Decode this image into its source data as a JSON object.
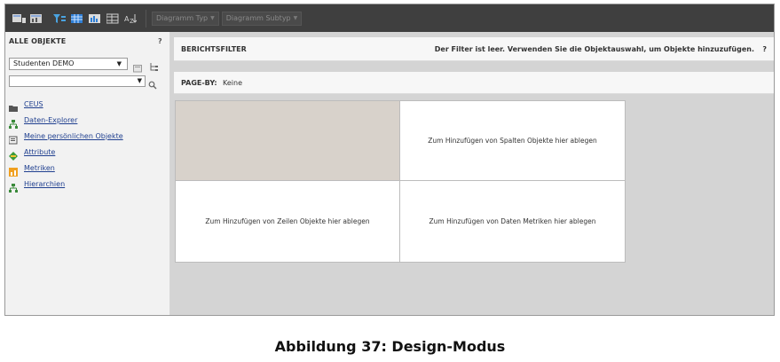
{
  "toolbar": {
    "icons": [
      "grid-view-icon",
      "grid-graph-view-icon",
      "filter-icon",
      "table-view-icon",
      "graph-view-icon",
      "layout-icon",
      "sort-icon"
    ],
    "diagramm_typ": "Diagramm Typ",
    "diagramm_subtyp": "Diagramm Subtyp"
  },
  "left_panel": {
    "title": "ALLE OBJEKTE",
    "help": "?",
    "project_select": "Studenten DEMO",
    "search_value": "",
    "tree": [
      {
        "label": "CEUS",
        "icon": "folder-icon"
      },
      {
        "label": "Daten-Explorer",
        "icon": "hierarchy-icon"
      },
      {
        "label": "Meine persönlichen Objekte",
        "icon": "personal-folder-icon"
      },
      {
        "label": "Attribute",
        "icon": "attribute-icon"
      },
      {
        "label": "Metriken",
        "icon": "metric-icon"
      },
      {
        "label": "Hierarchien",
        "icon": "hierarchy-icon"
      }
    ]
  },
  "main": {
    "filter_title": "BERICHTSFILTER",
    "filter_message": "Der Filter ist leer. Verwenden Sie die Objektauswahl, um Objekte hinzuzufügen.",
    "filter_help": "?",
    "pageby_label": "PAGE-BY:",
    "pageby_value": "Keine",
    "drop_columns": "Zum Hinzufügen von Spalten Objekte hier ablegen",
    "drop_rows": "Zum Hinzufügen von Zeilen Objekte hier ablegen",
    "drop_metrics": "Zum Hinzufügen von Daten Metriken hier ablegen"
  },
  "caption": "Abbildung 37: Design-Modus",
  "colors": {
    "toolbar_bg": "#3f3f3f",
    "panel_bg": "#f2f2f2",
    "canvas_bg": "#d4d4d4",
    "corner_cell": "#d8d2cb",
    "link": "#1f3f8f"
  }
}
